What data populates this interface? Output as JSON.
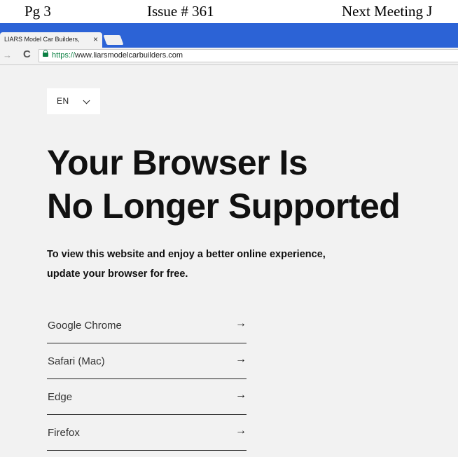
{
  "doc_header": {
    "page": "Pg 3",
    "issue": "Issue # 361",
    "meeting": "Next Meeting  J"
  },
  "browser": {
    "tab_title": "LIARS Model Car Builders,",
    "tab_close": "×",
    "url_scheme": "https://",
    "url_host": "www.liarsmodelcarbuilders.com"
  },
  "page": {
    "language": "EN",
    "headline_line1": "Your Browser Is",
    "headline_line2": "No Longer Supported",
    "subtext_line1": "To view this website and enjoy a better online experience,",
    "subtext_line2": "update your browser for free.",
    "browsers": [
      {
        "name": "Google Chrome",
        "arrow": "→"
      },
      {
        "name": "Safari (Mac)",
        "arrow": "→"
      },
      {
        "name": "Edge",
        "arrow": "→"
      },
      {
        "name": "Firefox",
        "arrow": "→"
      }
    ]
  },
  "colors": {
    "tabstrip": "#2c63d6",
    "page_background": "#f2f2f2",
    "secure_green": "#0b8043"
  },
  "icons": {
    "forward": "arrow-right-icon",
    "reload": "reload-icon",
    "lock": "lock-icon",
    "chevron": "chevron-down-icon"
  }
}
